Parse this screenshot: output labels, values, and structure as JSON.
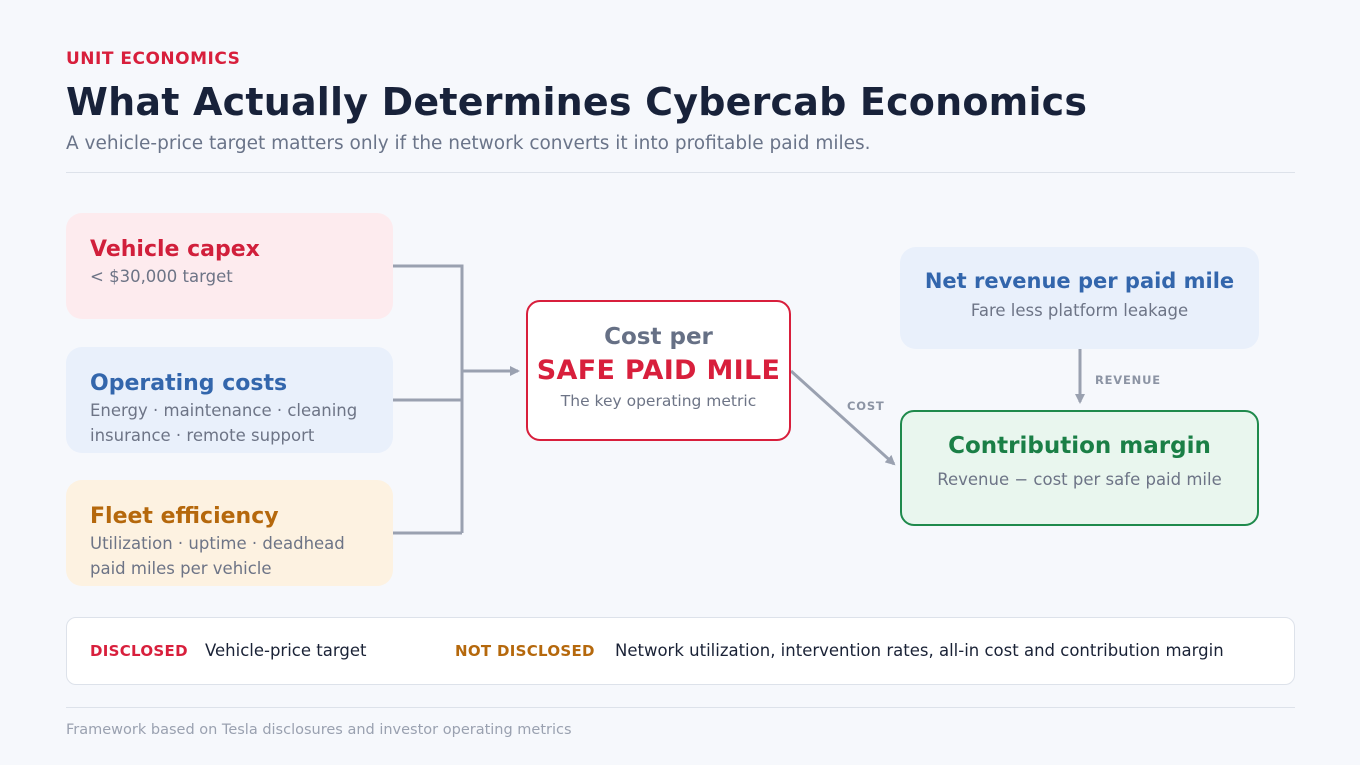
{
  "header": {
    "eyebrow": "UNIT ECONOMICS",
    "title": "What Actually Determines Cybercab Economics",
    "subtitle": "A vehicle-price target matters only if the network converts it into profitable paid miles."
  },
  "inputs": {
    "capex": {
      "title": "Vehicle capex",
      "line1": "< $30,000 target"
    },
    "opex": {
      "title": "Operating costs",
      "line1": "Energy · maintenance · cleaning",
      "line2": "insurance · remote support"
    },
    "fleet": {
      "title": "Fleet efficiency",
      "line1": "Utilization · uptime · deadhead",
      "line2": "paid miles per vehicle"
    }
  },
  "center": {
    "line1": "Cost per",
    "line2": "SAFE PAID MILE",
    "line3": "The key operating metric"
  },
  "revenue": {
    "title": "Net revenue per paid mile",
    "sub": "Fare less platform leakage"
  },
  "margin": {
    "title": "Contribution margin",
    "sub": "Revenue − cost per safe paid mile"
  },
  "flow_labels": {
    "cost": "COST",
    "revenue": "REVENUE"
  },
  "legend": {
    "disclosed_tag": "DISCLOSED",
    "disclosed_text": "Vehicle-price target",
    "not_disclosed_tag": "NOT DISCLOSED",
    "not_disclosed_text": "Network utilization, intervention rates, all-in cost and contribution margin"
  },
  "footer": "Framework based on Tesla disclosures and investor operating metrics",
  "colors": {
    "accent_red": "#d81f3c",
    "blue": "#3366ac",
    "orange": "#b5680c",
    "green": "#1a7f46",
    "connector": "#9aa1b0"
  }
}
